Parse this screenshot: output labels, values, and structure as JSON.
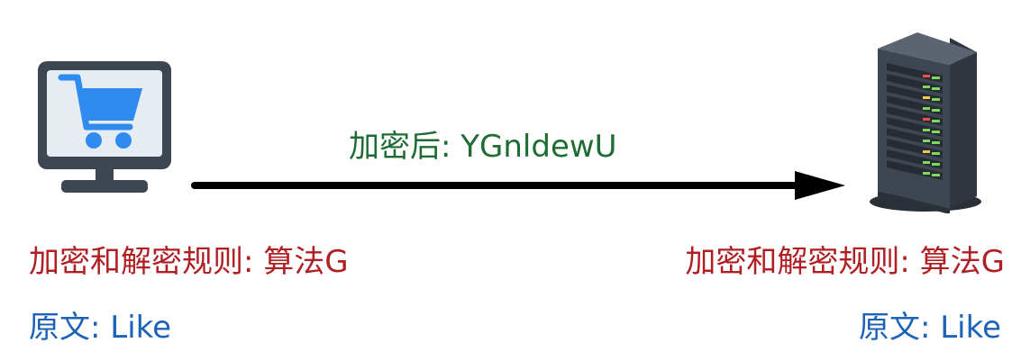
{
  "encryption": {
    "ciphertext_label": "加密后: YGnldewU"
  },
  "client": {
    "rule_label": "加密和解密规则: 算法G",
    "plaintext_label": "原文: Like",
    "icon": "shopping-cart-monitor-icon"
  },
  "server": {
    "rule_label": "加密和解密规则: 算法G",
    "plaintext_label": "原文: Like",
    "icon": "server-tower-icon"
  },
  "colors": {
    "ciphertext": "#1e6b34",
    "rule": "#b01f24",
    "plaintext": "#1c63b7",
    "arrow": "#000000",
    "monitor_frame": "#3d4752",
    "monitor_screen": "#e6edf2",
    "cart": "#2f8bf0",
    "server_body": "#3e4652",
    "server_led_green": "#7ed957",
    "server_led_red": "#ef4b4b"
  }
}
